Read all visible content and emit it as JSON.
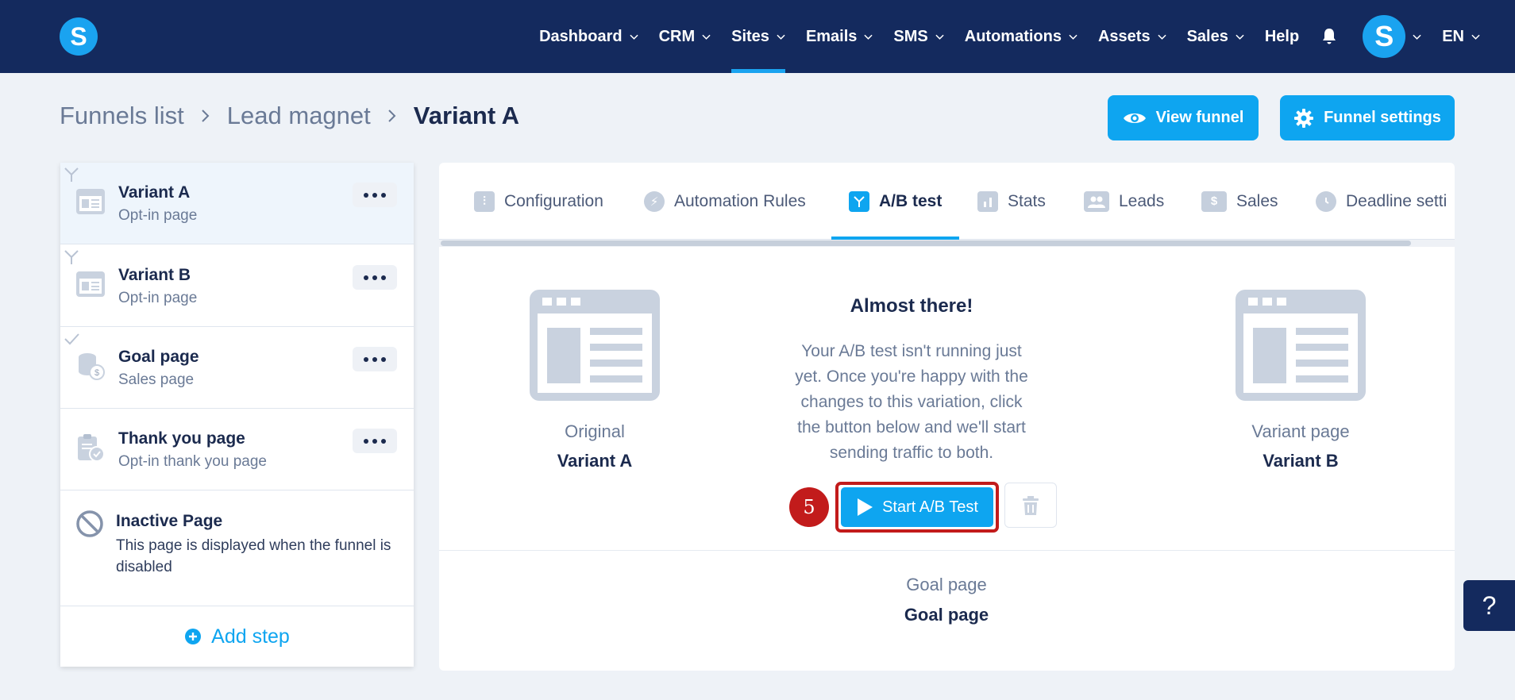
{
  "app": {
    "logo_letter": "S"
  },
  "nav": {
    "items": [
      {
        "label": "Dashboard"
      },
      {
        "label": "CRM"
      },
      {
        "label": "Sites"
      },
      {
        "label": "Emails"
      },
      {
        "label": "SMS"
      },
      {
        "label": "Automations"
      },
      {
        "label": "Assets"
      },
      {
        "label": "Sales"
      },
      {
        "label": "Help"
      }
    ],
    "active": "Sites",
    "avatar_letter": "S",
    "language": "EN"
  },
  "breadcrumb": {
    "items": [
      "Funnels list",
      "Lead magnet",
      "Variant A"
    ]
  },
  "header_buttons": {
    "view_funnel": "View funnel",
    "funnel_settings": "Funnel settings"
  },
  "steps": [
    {
      "title": "Variant A",
      "subtitle": "Opt-in page",
      "selected": true
    },
    {
      "title": "Variant B",
      "subtitle": "Opt-in page"
    },
    {
      "title": "Goal page",
      "subtitle": "Sales page"
    },
    {
      "title": "Thank you page",
      "subtitle": "Opt-in thank you page"
    }
  ],
  "inactive_step": {
    "title": "Inactive Page",
    "description": "This page is displayed when the funnel is disabled"
  },
  "add_step_label": "Add step",
  "tabs": [
    {
      "label": "Configuration",
      "icon": "sliders-icon"
    },
    {
      "label": "Automation Rules",
      "icon": "bolt-icon"
    },
    {
      "label": "A/B test",
      "icon": "split-icon",
      "active": true
    },
    {
      "label": "Stats",
      "icon": "bar-chart-icon"
    },
    {
      "label": "Leads",
      "icon": "users-icon"
    },
    {
      "label": "Sales",
      "icon": "dollar-icon"
    },
    {
      "label": "Deadline setti",
      "icon": "clock-icon"
    }
  ],
  "ab_test": {
    "original": {
      "label": "Original",
      "name": "Variant A"
    },
    "variant": {
      "label": "Variant page",
      "name": "Variant B"
    },
    "headline": "Almost there!",
    "explanation": "Your A/B test isn't running just yet. Once you're happy with the changes to this variation, click the button below and we'll start sending traffic to both.",
    "start_button": "Start A/B Test",
    "step_marker": "5",
    "goal": {
      "label": "Goal page",
      "name": "Goal page"
    }
  },
  "help_button": "?",
  "colors": {
    "nav_bg": "#142a5e",
    "accent": "#0ea5f0",
    "highlight": "#c21b1b",
    "page_bg": "#eef2f7"
  }
}
